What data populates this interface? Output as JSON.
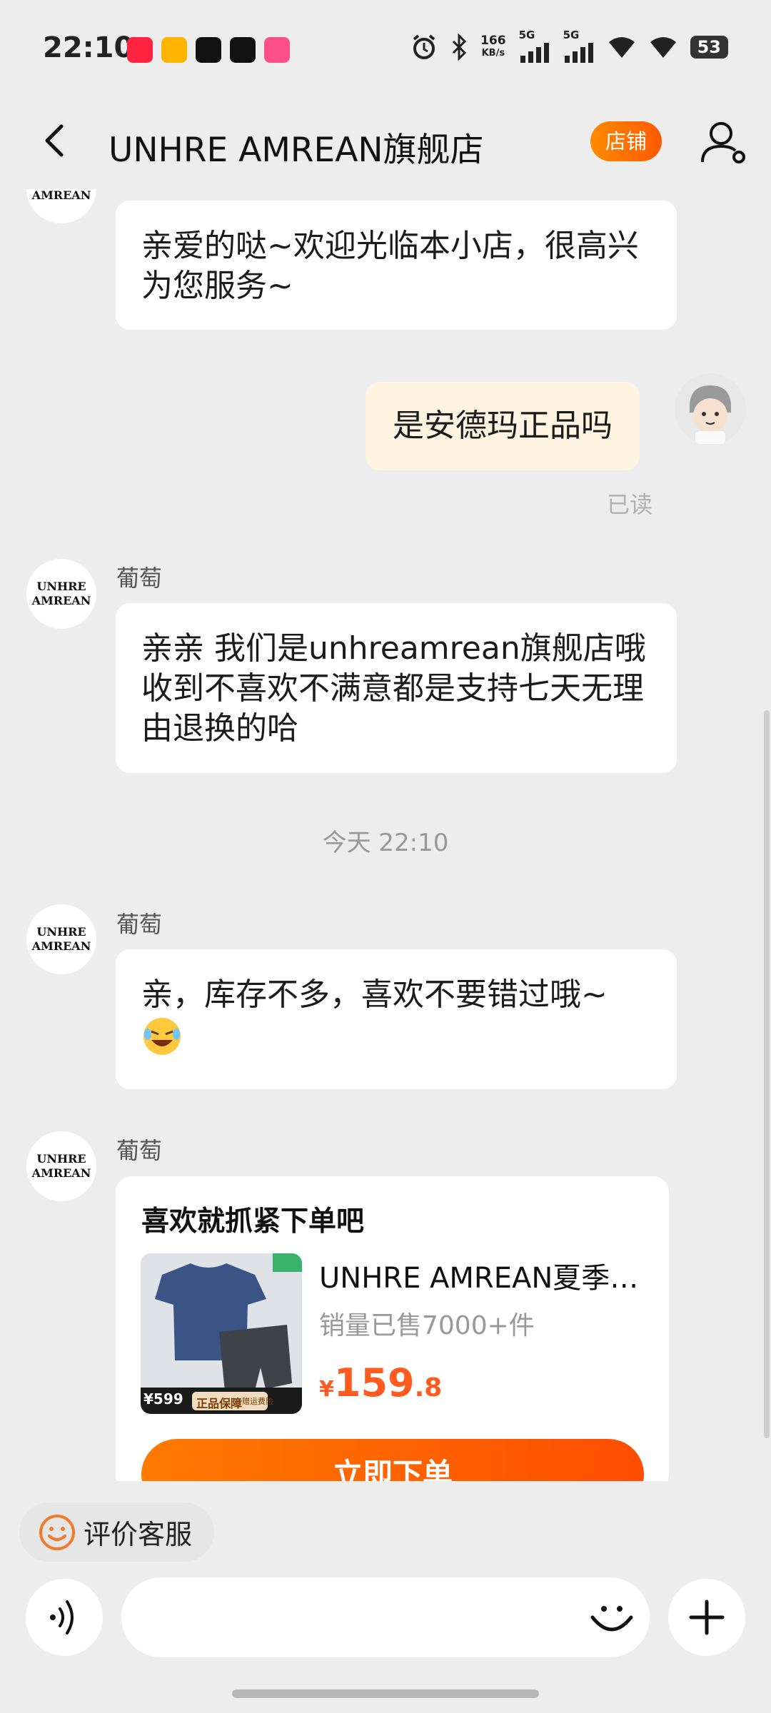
{
  "status_bar": {
    "time": "22:10",
    "net_speed_value": "166",
    "net_speed_unit": "KB/s",
    "signal_1_label": "5G",
    "signal_2_label": "5G",
    "battery": "53",
    "app_icons": [
      "xiaohongshu-icon",
      "weibo-icon",
      "capcut-icon",
      "tiktok-icon",
      "bilibili-icon"
    ],
    "status_icons": [
      "alarm-icon",
      "bluetooth-icon",
      "signal-icon",
      "signal-icon",
      "wifi-icon",
      "wifi-icon",
      "battery-icon"
    ]
  },
  "header": {
    "title": "UNHRE AMREAN旗舰店",
    "store_button": "店铺"
  },
  "brand_avatar": {
    "line1": "UNHRE",
    "line2": "AMREAN"
  },
  "messages": [
    {
      "from": "shop",
      "text": "亲爱的哒~欢迎光临本小店，很高兴为您服务~"
    },
    {
      "from": "me",
      "text": "是安德玛正品吗",
      "status": "已读"
    },
    {
      "from": "shop",
      "sender": "葡萄",
      "text": "亲亲 我们是unhreamrean旗舰店哦 收到不喜欢不满意都是支持七天无理由退换的哈"
    },
    {
      "type": "time",
      "text": "今天  22:10"
    },
    {
      "from": "shop",
      "sender": "葡萄",
      "text": "亲，库存不多，喜欢不要错过哦~",
      "emoji": "laughing-crying-emoji"
    },
    {
      "from": "shop",
      "sender": "葡萄",
      "type": "product_card"
    }
  ],
  "product_card": {
    "title": "喜欢就抓紧下单吧",
    "name": "UNHRE AMREAN夏季…",
    "sales": "销量已售7000+件",
    "price_symbol": "¥",
    "price_int": "159",
    "price_dec": ".8",
    "image_badge_price": "¥599",
    "image_badge_tag": "正品保障",
    "image_badge_sub": "赠运费险",
    "order_button": "立即下单"
  },
  "bottom": {
    "rate_label": "评价客服"
  },
  "colors": {
    "accent": "#ff5a00",
    "background": "#ededed",
    "my_bubble": "#fff4e1",
    "price": "#ff5a1f"
  }
}
